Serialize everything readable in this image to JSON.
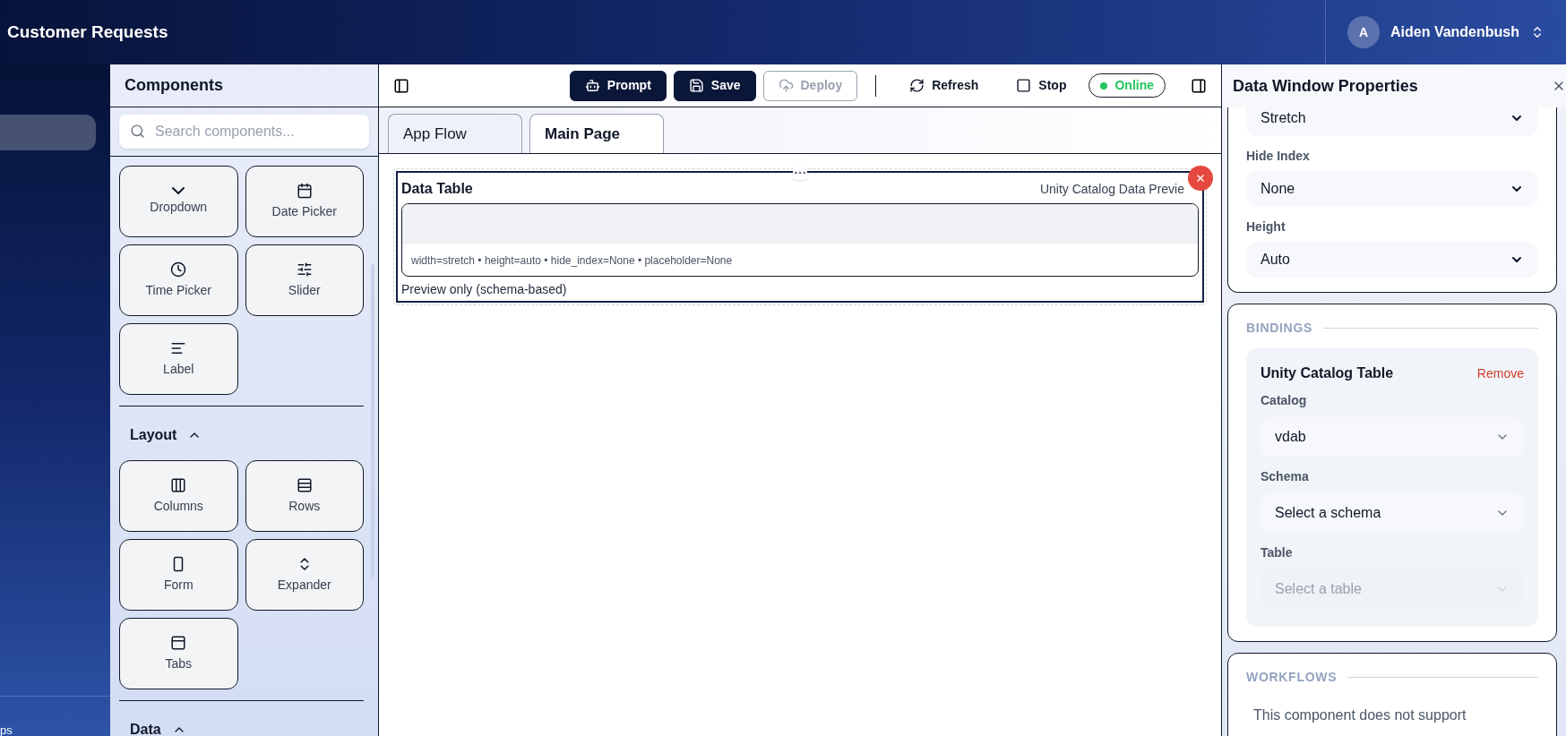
{
  "header": {
    "title": "Customer Requests",
    "user": {
      "initial": "A",
      "name": "Aiden Vandenbush"
    }
  },
  "sidebar": {
    "items": [
      {
        "selected": true
      }
    ],
    "footer_text": "ps"
  },
  "components_panel": {
    "title": "Components",
    "search": {
      "placeholder": "Search components..."
    },
    "sections": [
      {
        "items": [
          "Dropdown",
          "Date Picker",
          "Time Picker",
          "Slider",
          "Label"
        ]
      },
      {
        "title": "Layout",
        "expanded": true,
        "items": [
          "Columns",
          "Rows",
          "Form",
          "Expander",
          "Tabs"
        ]
      },
      {
        "title": "Data",
        "expanded": true
      }
    ]
  },
  "toolbar": {
    "buttons": [
      {
        "label": "Prompt",
        "kind": "primary",
        "disabled": false
      },
      {
        "label": "Save",
        "kind": "primary",
        "disabled": false
      },
      {
        "label": "Deploy",
        "kind": "outline",
        "disabled": true
      },
      {
        "label": "Refresh",
        "kind": "ghost",
        "disabled": false
      },
      {
        "label": "Stop",
        "kind": "ghost",
        "disabled": false
      }
    ],
    "status": {
      "label": "Online",
      "color": "#22c55e"
    }
  },
  "tabs": [
    {
      "label": "App Flow",
      "selected": false
    },
    {
      "label": "Main Page",
      "selected": true
    }
  ],
  "canvas": {
    "component": {
      "title": "Data Table",
      "subtitle": "Unity Catalog Data Previe",
      "meta": "width=stretch • height=auto • hide_index=None • placeholder=None",
      "note": "Preview only (schema-based)",
      "selected": true
    }
  },
  "properties": {
    "title": "Data Window Properties",
    "fields": [
      {
        "value": "Stretch"
      },
      {
        "label": "Hide Index",
        "value": "None"
      },
      {
        "label": "Height",
        "value": "Auto"
      }
    ],
    "bindings": {
      "title": "BINDINGS",
      "card": {
        "title": "Unity Catalog Table",
        "action": "Remove",
        "fields": [
          {
            "label": "Catalog",
            "value": "vdab",
            "disabled": false
          },
          {
            "label": "Schema",
            "value": "Select a schema",
            "disabled": false
          },
          {
            "label": "Table",
            "placeholder": "Select a table",
            "disabled": true
          }
        ]
      }
    },
    "workflows": {
      "title": "WORKFLOWS",
      "text": "This component does not support"
    }
  }
}
